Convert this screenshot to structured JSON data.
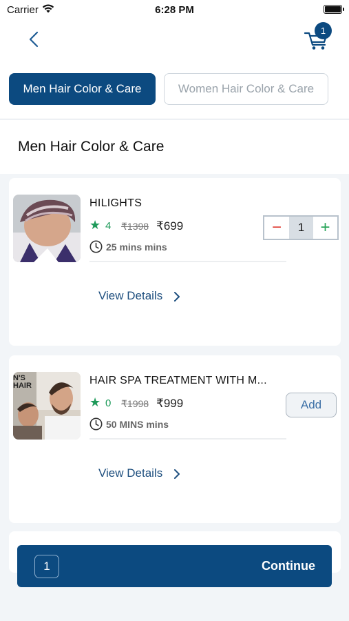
{
  "status_bar": {
    "carrier": "Carrier",
    "time": "6:28 PM"
  },
  "header": {
    "cart_count": "1"
  },
  "tabs": [
    {
      "label": "Men Hair Color & Care",
      "active": true
    },
    {
      "label": "Women Hair Color & Care",
      "active": false
    }
  ],
  "section": {
    "title": "Men Hair Color & Care"
  },
  "services": [
    {
      "name": "HILIGHTS",
      "rating": "4",
      "original_price": "₹1398",
      "price": "₹699",
      "duration": "25 mins mins",
      "quantity": "1",
      "view_details_label": "View Details"
    },
    {
      "name": "HAIR SPA TREATMENT WITH M...",
      "rating": "0",
      "original_price": "₹1998",
      "price": "₹999",
      "duration": "50 MINS mins",
      "add_label": "Add",
      "view_details_label": "View Details",
      "image_text": "N'S\nHAIR"
    }
  ],
  "footer": {
    "count": "1",
    "continue_label": "Continue"
  },
  "colors": {
    "primary": "#0c4a80",
    "rating_green": "#1e9a5a",
    "minus_red": "#e0433a",
    "plus_green": "#2aa55a",
    "background": "#f2f5f8"
  }
}
